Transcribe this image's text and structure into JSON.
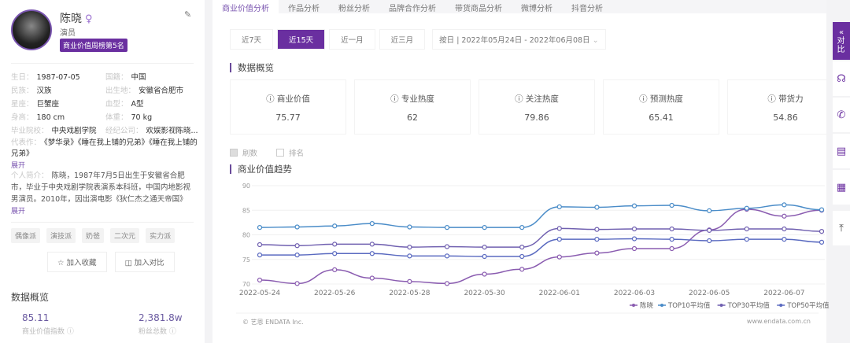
{
  "profile": {
    "name": "陈晓",
    "gender_icon": "♀",
    "role": "演员",
    "rank_badge": "商业价值周榜第5名",
    "info": [
      {
        "label": "生日：",
        "value": "1987-07-05"
      },
      {
        "label": "国籍：",
        "value": "中国"
      },
      {
        "label": "民族：",
        "value": "汉族"
      },
      {
        "label": "出生地：",
        "value": "安徽省合肥市"
      },
      {
        "label": "星座：",
        "value": "巨蟹座"
      },
      {
        "label": "血型：",
        "value": "A型"
      },
      {
        "label": "身高：",
        "value": "180 cm"
      },
      {
        "label": "体重：",
        "value": "70 kg"
      },
      {
        "label": "毕业院校：",
        "value": "中央戏剧学院"
      },
      {
        "label": "经纪公司：",
        "value": "欢娱影视陈晓..."
      }
    ],
    "works_label": "代表作：",
    "works": "《梦华录》《睡在我上铺的兄弟》《睡在我上铺的兄弟》",
    "expand": "展开",
    "intro_label": "个人简介：",
    "intro": "陈晓，1987年7月5日出生于安徽省合肥市，毕业于中央戏剧学院表演系本科班，中国内地影视男演员。2010年，因出演电影《狄仁杰之通天帝国》",
    "tags": [
      "偶像派",
      "演技派",
      "奶爸",
      "二次元",
      "实力派"
    ],
    "fav_btn": "加入收藏",
    "cmp_btn": "加入对比",
    "overview_title": "数据概览",
    "overview": [
      {
        "value": "85.11",
        "label": "商业价值指数"
      },
      {
        "value": "2,381.8w",
        "label": "粉丝总数"
      }
    ]
  },
  "tabs": [
    "商业价值分析",
    "作品分析",
    "粉丝分析",
    "品牌合作分析",
    "带货商品分析",
    "微博分析",
    "抖音分析"
  ],
  "ranges": [
    "近7天",
    "近15天",
    "近一月",
    "近三月"
  ],
  "active_range": 1,
  "date_range": "按日 | 2022年05月24日 - 2022年06月08日",
  "overview_title": "数据概览",
  "cards": [
    {
      "label": "商业价值",
      "value": "75.77"
    },
    {
      "label": "专业热度",
      "value": "62"
    },
    {
      "label": "关注热度",
      "value": "79.86"
    },
    {
      "label": "预测热度",
      "value": "65.41"
    },
    {
      "label": "带货力",
      "value": "54.86"
    }
  ],
  "checks": [
    {
      "label": "刷数",
      "checked": true
    },
    {
      "label": "排名",
      "checked": false
    }
  ],
  "trend_title": "商业价值趋势",
  "footer_left": "© 艺恩 ENDATA Inc.",
  "footer_right": "www.endata.com.cn",
  "side": {
    "compare": "对比",
    "compare_arrow": "«"
  },
  "chart_data": {
    "type": "line",
    "ylim": [
      70,
      90
    ],
    "yticks": [
      70,
      75,
      80,
      85,
      90
    ],
    "x": [
      "2022-05-24",
      "2022-05-25",
      "2022-05-26",
      "2022-05-27",
      "2022-05-28",
      "2022-05-29",
      "2022-05-30",
      "2022-05-31",
      "2022-06-01",
      "2022-06-02",
      "2022-06-03",
      "2022-06-04",
      "2022-06-05",
      "2022-06-06",
      "2022-06-07",
      "2022-06-08"
    ],
    "xticks": [
      "2022-05-24",
      "2022-05-26",
      "2022-05-28",
      "2022-05-30",
      "2022-06-01",
      "2022-06-03",
      "2022-06-05",
      "2022-06-07"
    ],
    "legend_position": "bottom-right",
    "series": [
      {
        "name": "陈晓",
        "color": "#8a5cb0",
        "values": [
          70.8,
          70.1,
          72.9,
          71.2,
          70.5,
          70.1,
          72.0,
          73.0,
          75.5,
          76.3,
          77.2,
          77.2,
          81.0,
          85.2,
          83.8,
          85.0
        ]
      },
      {
        "name": "TOP10平均值",
        "color": "#4a8cc8",
        "values": [
          81.5,
          81.6,
          81.8,
          82.3,
          81.6,
          81.5,
          81.5,
          81.5,
          85.7,
          85.6,
          85.9,
          86.0,
          84.9,
          85.4,
          86.1,
          85.1
        ]
      },
      {
        "name": "TOP30平均值",
        "color": "#7060b0",
        "values": [
          78.0,
          77.8,
          78.1,
          78.1,
          77.5,
          77.6,
          77.5,
          77.5,
          81.3,
          81.1,
          81.2,
          81.2,
          80.9,
          81.2,
          81.2,
          80.7
        ]
      },
      {
        "name": "TOP50平均值",
        "color": "#5a6ac0",
        "values": [
          75.9,
          75.9,
          76.2,
          76.2,
          75.7,
          75.7,
          75.6,
          75.6,
          79.1,
          79.1,
          79.2,
          79.1,
          78.8,
          79.1,
          79.1,
          78.5
        ]
      }
    ]
  }
}
